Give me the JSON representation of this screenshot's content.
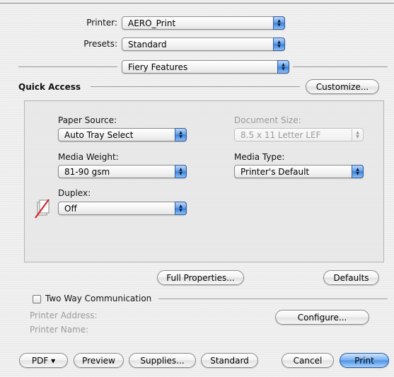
{
  "printer": {
    "label": "Printer:",
    "value": "AERO_Print"
  },
  "presets": {
    "label": "Presets:",
    "value": "Standard"
  },
  "section_menu": {
    "value": "Fiery Features"
  },
  "quick_access": {
    "title": "Quick Access",
    "customize_label": "Customize...",
    "paper_source": {
      "label": "Paper Source:",
      "value": "Auto Tray Select"
    },
    "document_size": {
      "label": "Document Size:",
      "value": "8.5 x 11 Letter LEF",
      "enabled": false
    },
    "media_weight": {
      "label": "Media Weight:",
      "value": "81-90 gsm"
    },
    "media_type": {
      "label": "Media Type:",
      "value": "Printer's Default"
    },
    "duplex": {
      "label": "Duplex:",
      "value": "Off",
      "icon": "duplex-off-icon"
    },
    "full_properties_label": "Full Properties...",
    "defaults_label": "Defaults"
  },
  "two_way": {
    "checkbox_label": "Two Way Communication",
    "checked": false,
    "printer_address_label": "Printer Address:",
    "printer_name_label": "Printer Name:",
    "configure_label": "Configure..."
  },
  "bottom": {
    "pdf_label": "PDF ▾",
    "preview_label": "Preview",
    "supplies_label": "Supplies...",
    "standard_label": "Standard",
    "cancel_label": "Cancel",
    "print_label": "Print"
  },
  "colors": {
    "accent": "#4d90e6",
    "disabled_text": "#9a9a9a"
  }
}
